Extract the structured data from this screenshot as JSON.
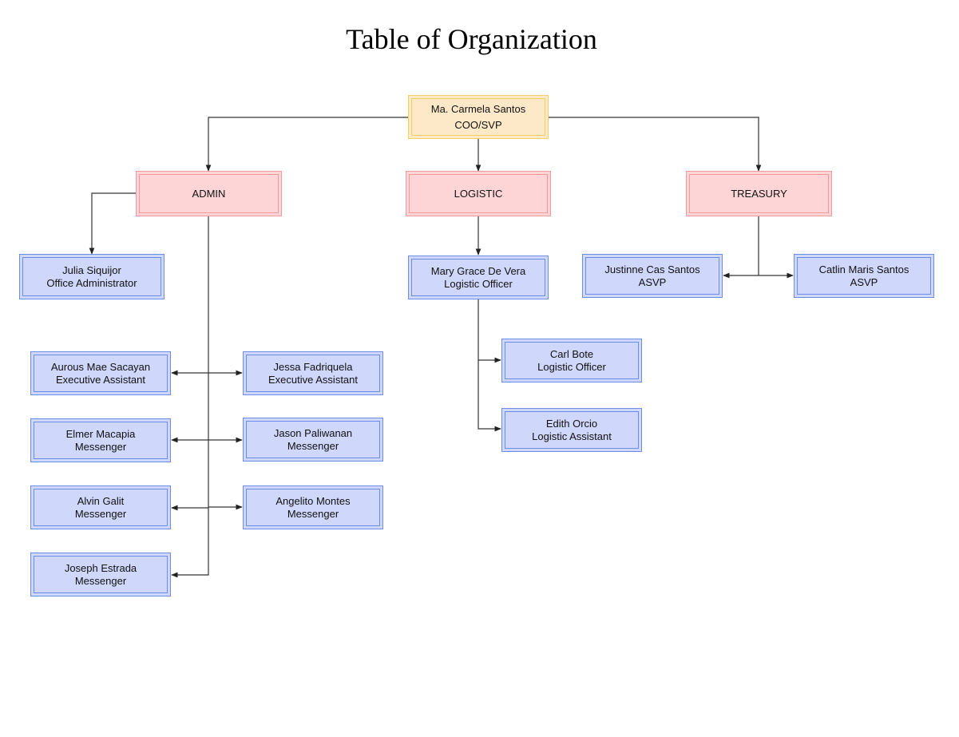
{
  "title": "Table of Organization",
  "colors": {
    "executive_fill": "#fde9c7",
    "executive_border": "#f3d160",
    "department_fill": "#fdd5d6",
    "department_border": "#f29a9c",
    "staff_fill": "#cfd7fb",
    "staff_border": "#6b8de8",
    "connector": "#333333"
  },
  "executive": {
    "name": "Ma. Carmela Santos",
    "role": "COO/SVP"
  },
  "departments": [
    {
      "name": "ADMIN"
    },
    {
      "name": "LOGISTIC"
    },
    {
      "name": "TREASURY"
    }
  ],
  "admin_staff": [
    {
      "name": "Julia Siquijor",
      "role": "Office Administrator"
    },
    {
      "name": "Aurous Mae Sacayan",
      "role": "Executive Assistant"
    },
    {
      "name": "Jessa Fadriquela",
      "role": "Executive Assistant"
    },
    {
      "name": "Elmer Macapia",
      "role": "Messenger"
    },
    {
      "name": "Jason Paliwanan",
      "role": "Messenger"
    },
    {
      "name": "Alvin Galit",
      "role": "Messenger"
    },
    {
      "name": "Angelito Montes",
      "role": "Messenger"
    },
    {
      "name": "Joseph Estrada",
      "role": "Messenger"
    }
  ],
  "logistic_staff": [
    {
      "name": "Mary Grace De Vera",
      "role": "Logistic Officer"
    },
    {
      "name": "Carl Bote",
      "role": "Logistic Officer"
    },
    {
      "name": "Edith Orcio",
      "role": "Logistic Assistant"
    }
  ],
  "treasury_staff": [
    {
      "name": "Justinne Cas Santos",
      "role": "ASVP"
    },
    {
      "name": "Catlin Maris Santos",
      "role": "ASVP"
    }
  ]
}
